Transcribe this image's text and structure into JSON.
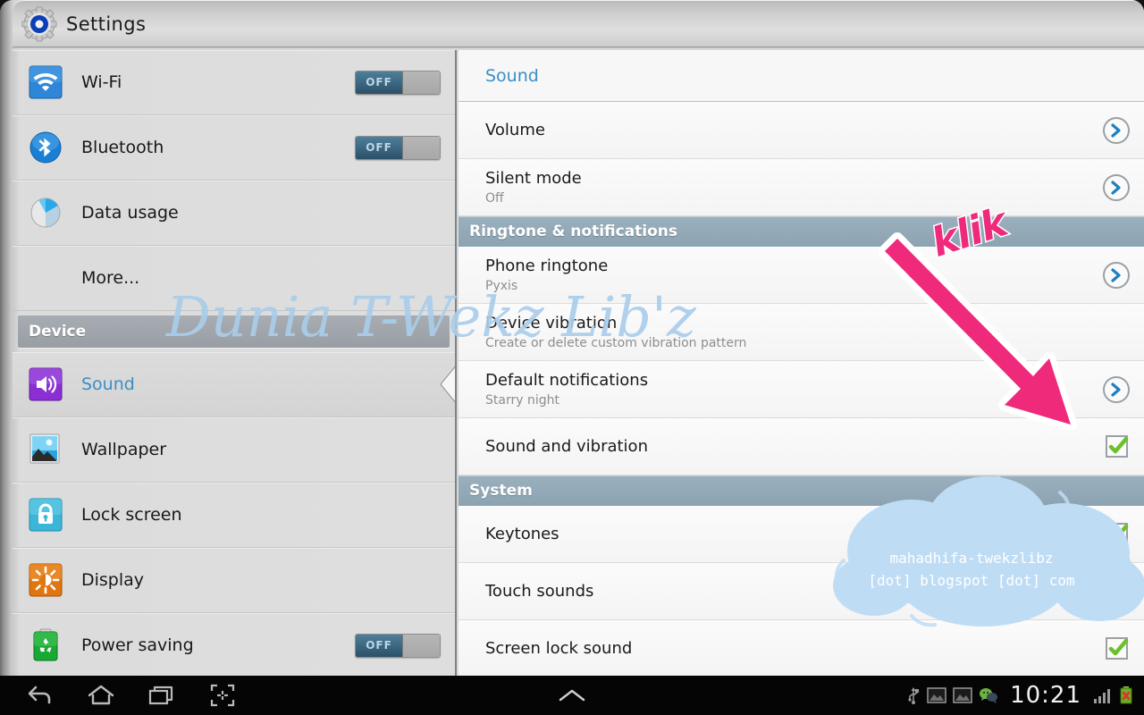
{
  "window": {
    "app_title": "Settings",
    "app_icon": "gear-icon"
  },
  "sidebar": {
    "items": [
      {
        "label": "Wi-Fi",
        "icon": "wifi-icon",
        "toggle": "OFF",
        "type": "toggle"
      },
      {
        "label": "Bluetooth",
        "icon": "bluetooth-icon",
        "toggle": "OFF",
        "type": "toggle"
      },
      {
        "label": "Data usage",
        "icon": "data-usage-icon",
        "type": "plain"
      },
      {
        "label": "More...",
        "icon": "",
        "type": "indent"
      }
    ],
    "section_device": "Device",
    "device_items": [
      {
        "label": "Sound",
        "icon": "sound-icon",
        "type": "selected"
      },
      {
        "label": "Wallpaper",
        "icon": "wallpaper-icon",
        "type": "plain"
      },
      {
        "label": "Lock screen",
        "icon": "lock-icon",
        "type": "plain"
      },
      {
        "label": "Display",
        "icon": "display-icon",
        "type": "plain"
      },
      {
        "label": "Power saving",
        "icon": "power-saving-icon",
        "toggle": "OFF",
        "type": "toggle"
      }
    ]
  },
  "content": {
    "title": "Sound",
    "rows": [
      {
        "kind": "item",
        "title": "Volume",
        "subtitle": "",
        "control": "chevron"
      },
      {
        "kind": "item",
        "title": "Silent mode",
        "subtitle": "Off",
        "control": "chevron"
      },
      {
        "kind": "header",
        "title": "Ringtone & notifications"
      },
      {
        "kind": "item",
        "title": "Phone ringtone",
        "subtitle": "Pyxis",
        "control": "chevron"
      },
      {
        "kind": "item",
        "title": "Device vibration",
        "subtitle": "Create or delete custom vibration pattern",
        "control": "none"
      },
      {
        "kind": "item",
        "title": "Default notifications",
        "subtitle": "Starry night",
        "control": "chevron"
      },
      {
        "kind": "item",
        "title": "Sound and vibration",
        "subtitle": "",
        "control": "checkbox",
        "checked": true
      },
      {
        "kind": "header",
        "title": "System"
      },
      {
        "kind": "item",
        "title": "Keytones",
        "subtitle": "",
        "control": "checkbox",
        "checked": true
      },
      {
        "kind": "item",
        "title": "Touch sounds",
        "subtitle": "",
        "control": "checkbox",
        "checked": true
      },
      {
        "kind": "item",
        "title": "Screen lock sound",
        "subtitle": "",
        "control": "checkbox",
        "checked": true
      }
    ]
  },
  "annotation": {
    "klik_label": "klik",
    "arrow_color": "#ef2a7b"
  },
  "watermarks": {
    "main": "Dunia T-Wekz Lib'z",
    "cloud_line1": "mahadhifa-twekzlibz",
    "cloud_line2": "[dot] blogspot [dot] com"
  },
  "navbar": {
    "back": "back-icon",
    "home": "home-icon",
    "recents": "recents-icon",
    "screenshot": "screenshot-icon",
    "up_arrow": "chevron-up-icon",
    "status_icons": [
      "usb-icon",
      "screenshot-capture-icon",
      "screenshot-capture-icon",
      "wechat-icon"
    ],
    "clock": "10:21",
    "signal": "signal-bars-icon",
    "battery": "battery-error-icon"
  },
  "colors": {
    "accent_blue": "#3a8fc4",
    "header_blue_gray": "#8ca3b2",
    "header_gray": "#989ea3",
    "check_green": "#6bc12a",
    "pink": "#ef2a7b",
    "watermark_blue": "#aacdea"
  }
}
